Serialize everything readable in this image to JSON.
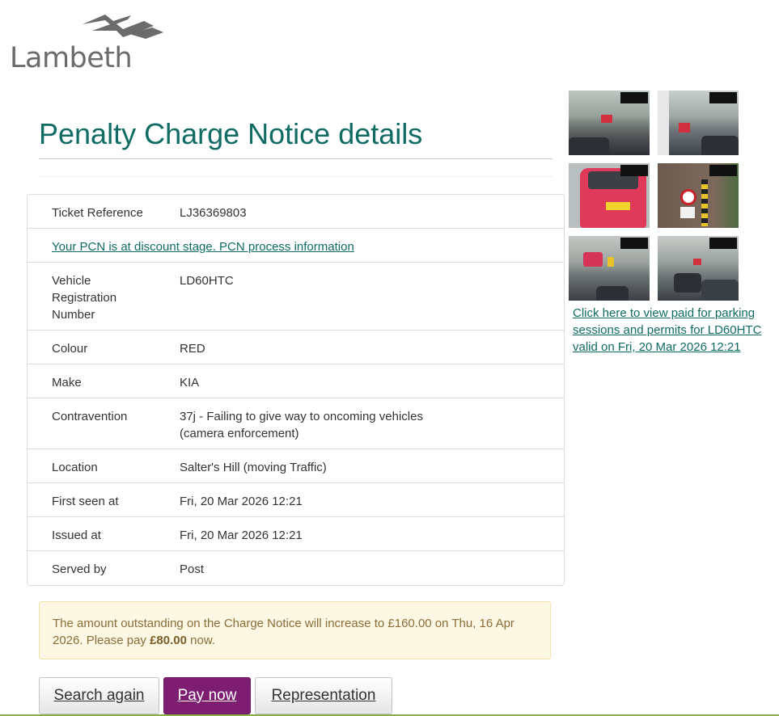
{
  "brand": {
    "name": "Lambeth",
    "logo_icon": "lambeth-wave-icon",
    "accent": "#0f6b63",
    "button_purple": "#7d1e73"
  },
  "page": {
    "title": "Penalty Charge Notice details"
  },
  "details": {
    "ticket_reference": {
      "label": "Ticket Reference",
      "value": "LJ36369803"
    },
    "pcn_info_link": "Your PCN is at discount stage. PCN process information",
    "vehicle": {
      "label_lines": [
        "Vehicle",
        "Registration",
        "Number"
      ],
      "value": "LD60HTC"
    },
    "colour": {
      "label": "Colour",
      "value": "RED"
    },
    "make": {
      "label": "Make",
      "value": "KIA"
    },
    "contravention": {
      "label": "Contravention",
      "value_lines": [
        "37j - Failing to give way to oncoming vehicles",
        "(camera enforcement)"
      ]
    },
    "location": {
      "label": "Location",
      "value": "Salter's Hill (moving Traffic)"
    },
    "first_seen": {
      "label": "First seen at",
      "value": "Fri, 20 Mar 2026 12:21"
    },
    "issued": {
      "label": "Issued at",
      "value": "Fri, 20 Mar 2026 12:21"
    },
    "served": {
      "label": "Served by",
      "value": "Post"
    }
  },
  "alert": {
    "text_before": "The amount outstanding on the Charge Notice will increase to £160.00 on Thu, 16 Apr 2026. Please pay ",
    "amount": "£80.00",
    "text_after": " now."
  },
  "buttons": {
    "search_again": "Search again",
    "pay_now": "Pay now",
    "representation": "Representation"
  },
  "side": {
    "link": "Click here to view paid for parking sessions and permits for LD60HTC valid on Fri, 20 Mar 2026 12:21",
    "thumbnails": [
      "street-view-1",
      "street-view-2",
      "red-car-rear-closeup",
      "no-entry-sign",
      "street-view-3",
      "street-view-4"
    ]
  }
}
